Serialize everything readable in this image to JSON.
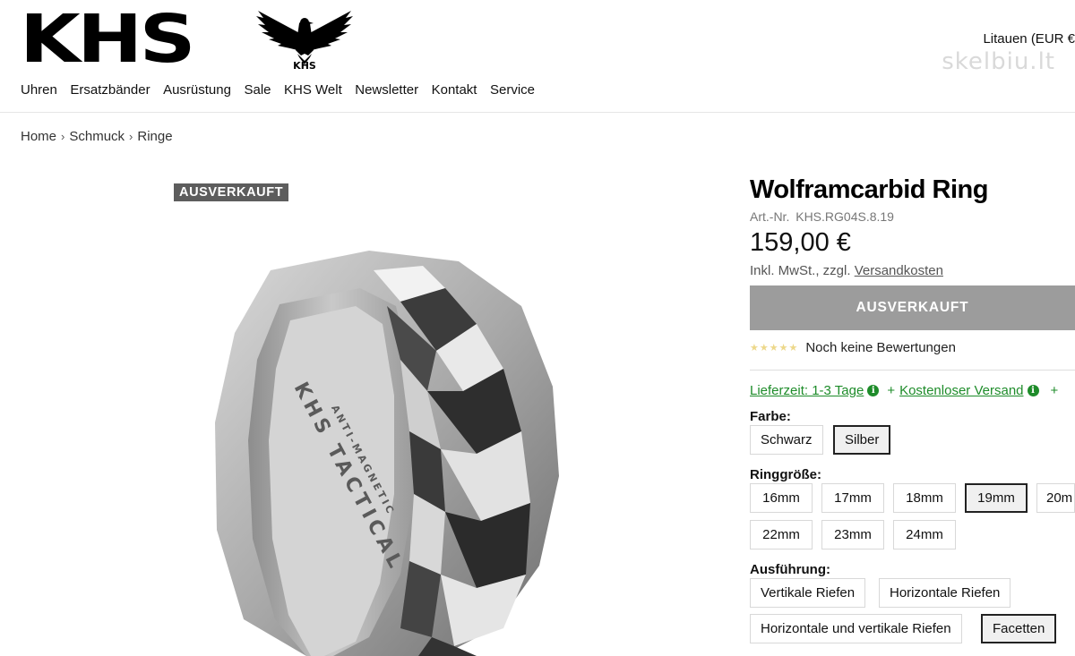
{
  "header": {
    "logo_text": "KHS",
    "locale": "Litauen (EUR €",
    "watermark": "skelbiu.lt",
    "nav": [
      "Uhren",
      "Ersatzbänder",
      "Ausrüstung",
      "Sale",
      "KHS Welt",
      "Newsletter",
      "Kontakt",
      "Service"
    ]
  },
  "breadcrumb": [
    "Home",
    "Schmuck",
    "Ringe"
  ],
  "product": {
    "badge": "AUSVERKAUFT",
    "ring_engraving": [
      "KHS TACTICAL",
      "ANTI-MAGNETIC"
    ],
    "title": "Wolframcarbid Ring",
    "sku_label": "Art.-Nr.",
    "sku": "KHS.RG04S.8.19",
    "price": "159,00 €",
    "tax_prefix": "Inkl. MwSt., zzgl.",
    "tax_link": "Versandkosten",
    "button_label": "AUSVERKAUFT",
    "stars": "★★★★★",
    "rating_text": "Noch keine Bewertungen",
    "shipping": {
      "delivery": "Lieferzeit: 1-3 Tage",
      "free": "Kostenloser Versand",
      "plus": "+"
    },
    "color": {
      "label": "Farbe:",
      "options": [
        "Schwarz",
        "Silber"
      ],
      "selected": "Silber"
    },
    "size": {
      "label": "Ringgröße:",
      "options": [
        "16mm",
        "17mm",
        "18mm",
        "19mm",
        "20m",
        "22mm",
        "23mm",
        "24mm"
      ],
      "selected": "19mm"
    },
    "finish": {
      "label": "Ausführung:",
      "options": [
        "Vertikale Riefen",
        "Horizontale Riefen",
        "Horizontale und vertikale Riefen",
        "Facetten"
      ],
      "selected": "Facetten"
    }
  },
  "colors": {
    "accent_green": "#1e8c2a",
    "sold_button": "#9c9c9c",
    "badge_bg": "#5d5d5d"
  }
}
